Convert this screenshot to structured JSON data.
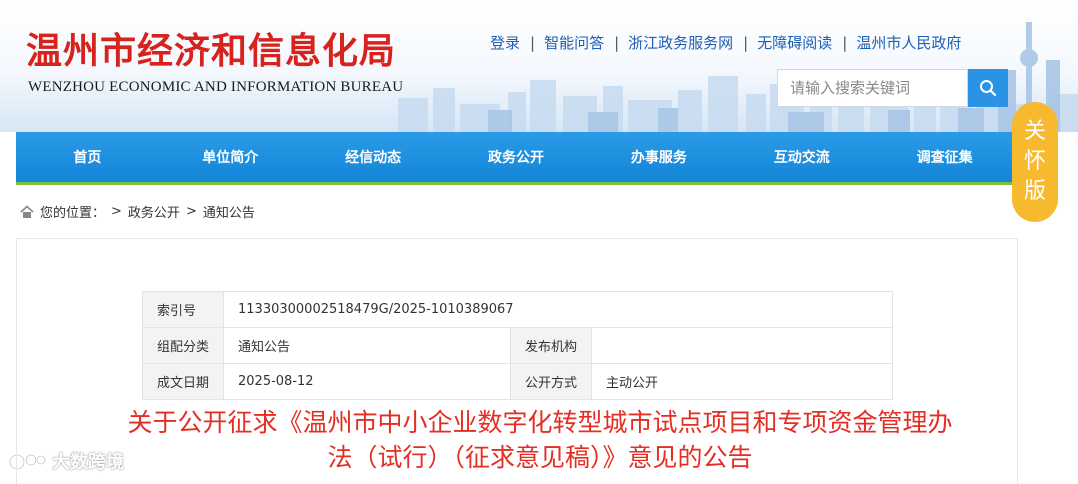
{
  "site": {
    "title_cn": "温州市经济和信息化局",
    "title_en": "WENZHOU ECONOMIC AND INFORMATION BUREAU"
  },
  "top_links": [
    {
      "label": "登录"
    },
    {
      "label": "智能问答"
    },
    {
      "label": "浙江政务服务网"
    },
    {
      "label": "无障碍阅读"
    },
    {
      "label": "温州市人民政府"
    }
  ],
  "search": {
    "placeholder": "请输入搜索关键词",
    "icon": "search-icon"
  },
  "care_badge": {
    "chars": [
      "关",
      "怀",
      "版"
    ]
  },
  "nav": {
    "items": [
      {
        "label": "首页"
      },
      {
        "label": "单位简介"
      },
      {
        "label": "经信动态"
      },
      {
        "label": "政务公开"
      },
      {
        "label": "办事服务"
      },
      {
        "label": "互动交流"
      },
      {
        "label": "调查征集"
      }
    ]
  },
  "breadcrumb": {
    "prefix": "您的位置：",
    "items": [
      "政务公开",
      "通知公告"
    ],
    "icon": "home-icon"
  },
  "meta": {
    "index_label": "索引号",
    "index_value": "11330300002518479G/2025-1010389067",
    "category_label": "组配分类",
    "category_value": "通知公告",
    "publisher_label": "发布机构",
    "publisher_value": "",
    "date_label": "成文日期",
    "date_value": "2025-08-12",
    "disclosure_label": "公开方式",
    "disclosure_value": "主动公开"
  },
  "article": {
    "title_line1": "关于公开征求《温州市中小企业数字化转型城市试点项目和专项资金管理办",
    "title_line2": "法（试行）（征求意见稿）》意见的公告"
  },
  "watermark": {
    "text": "大数跨境"
  },
  "colors": {
    "brand_red": "#d7221d",
    "nav_blue": "#1e8ee0",
    "accent_green": "#7fbf3f",
    "badge_yellow": "#f7b92e",
    "title_red": "#e52e23"
  }
}
